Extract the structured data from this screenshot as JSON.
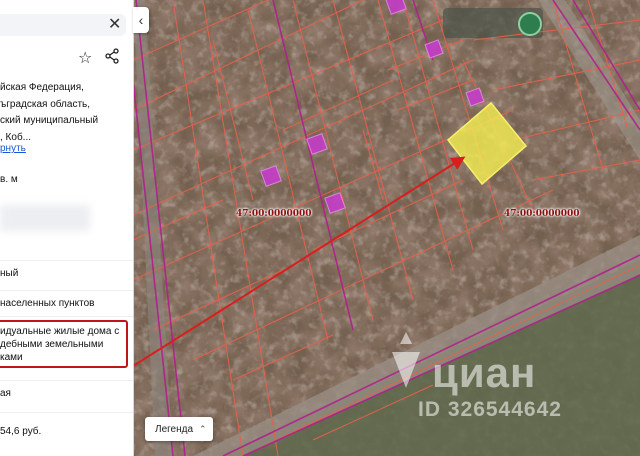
{
  "panel": {
    "address": [
      "йская Федерация,",
      "ъградская область,",
      "ский муниципальный",
      ", Коб..."
    ],
    "address_link": "рнуть",
    "area": "в. м",
    "rows": [
      {
        "text": "ный"
      },
      {
        "text": "населенных пунктов"
      },
      {
        "text": "ая"
      },
      {
        "text": "54,6 руб."
      }
    ],
    "permitted_use": [
      "идуальные жилые дома с",
      "дебными земельными",
      "ками"
    ]
  },
  "map": {
    "cadastral_labels": [
      "47:00:0000000",
      "47:00:0000000"
    ],
    "legend_label": "Легенда",
    "watermark_brand": "циан",
    "watermark_id": "ID 326544642",
    "colors": {
      "parcel_border": "#e8614c",
      "district_border": "#b0208c",
      "highlight_fill": "#f5ef52",
      "marker": "#c43cc8",
      "arrow": "#d91e1e"
    }
  }
}
